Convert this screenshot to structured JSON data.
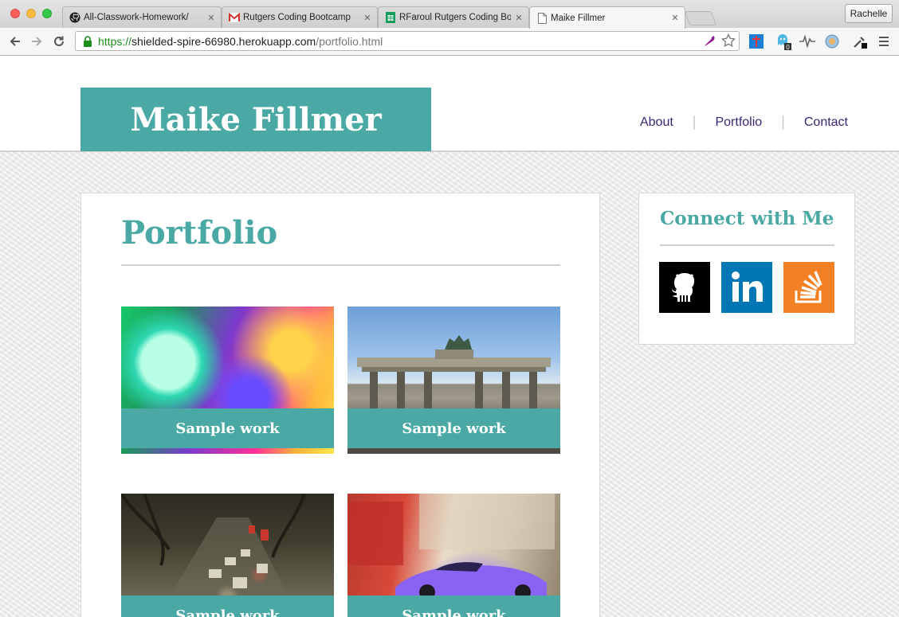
{
  "browser": {
    "tabs": [
      {
        "title": "All-Classwork-Homework/",
        "icon": "github-icon"
      },
      {
        "title": "Rutgers Coding Bootcamp",
        "icon": "gmail-icon"
      },
      {
        "title": "RFaroul Rutgers Coding Bo",
        "icon": "sheets-icon"
      },
      {
        "title": "Maike Fillmer",
        "icon": "page-icon"
      }
    ],
    "profile": "Rachelle",
    "url": {
      "scheme": "https://",
      "host": "shielded-spire-66980.herokuapp.com",
      "path": "/portfolio.html"
    },
    "extension_badge": "0",
    "accent_secure": "#1a8f1a"
  },
  "site": {
    "brand": "Maike Fillmer",
    "nav": [
      "About",
      "Portfolio",
      "Contact"
    ],
    "accent": "#4aa9a4",
    "nav_color": "#3b2573"
  },
  "portfolio": {
    "title": "Portfolio",
    "items": [
      {
        "caption": "Sample work",
        "image": "abstract-lights"
      },
      {
        "caption": "Sample work",
        "image": "brandenburg-gate"
      },
      {
        "caption": "Sample work",
        "image": "highway-traffic"
      },
      {
        "caption": "Sample work",
        "image": "purple-sports-car"
      }
    ]
  },
  "connect": {
    "title": "Connect with Me",
    "links": [
      {
        "name": "github",
        "icon": "github-icon",
        "color": "#000000"
      },
      {
        "name": "linkedin",
        "icon": "linkedin-icon",
        "color": "#0077b5"
      },
      {
        "name": "stackoverflow",
        "icon": "stackoverflow-icon",
        "color": "#f48024"
      }
    ]
  }
}
